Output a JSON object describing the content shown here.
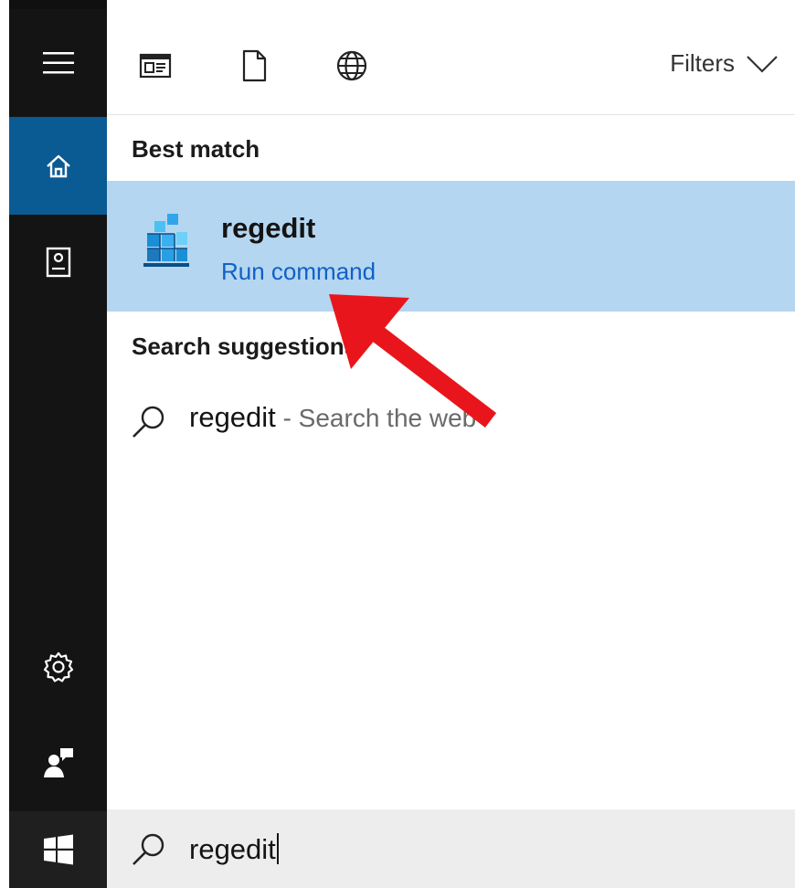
{
  "toolbar": {
    "filters_label": "Filters",
    "icons": [
      "apps-icon",
      "document-icon",
      "web-globe-icon"
    ]
  },
  "sidebar": {
    "items": [
      "menu-icon",
      "home-icon",
      "documents-icon",
      "settings-icon",
      "feedback-icon",
      "windows-start-icon"
    ]
  },
  "best_match": {
    "heading": "Best match",
    "title": "regedit",
    "subtitle": "Run command",
    "icon": "registry-editor-icon"
  },
  "suggestions": {
    "heading": "Search suggestions",
    "items": [
      {
        "term": "regedit",
        "rest": " - Search the web"
      }
    ]
  },
  "search": {
    "value": "regedit",
    "icon": "search-icon"
  },
  "annotation": {
    "type": "arrow",
    "color": "#e8161c",
    "target": "best-match-subtitle"
  },
  "colors": {
    "rail": "#141414",
    "rail_active": "#0a5a94",
    "highlight_row": "#b4d6f0",
    "link": "#1160c6",
    "search_bar": "#ededed"
  }
}
